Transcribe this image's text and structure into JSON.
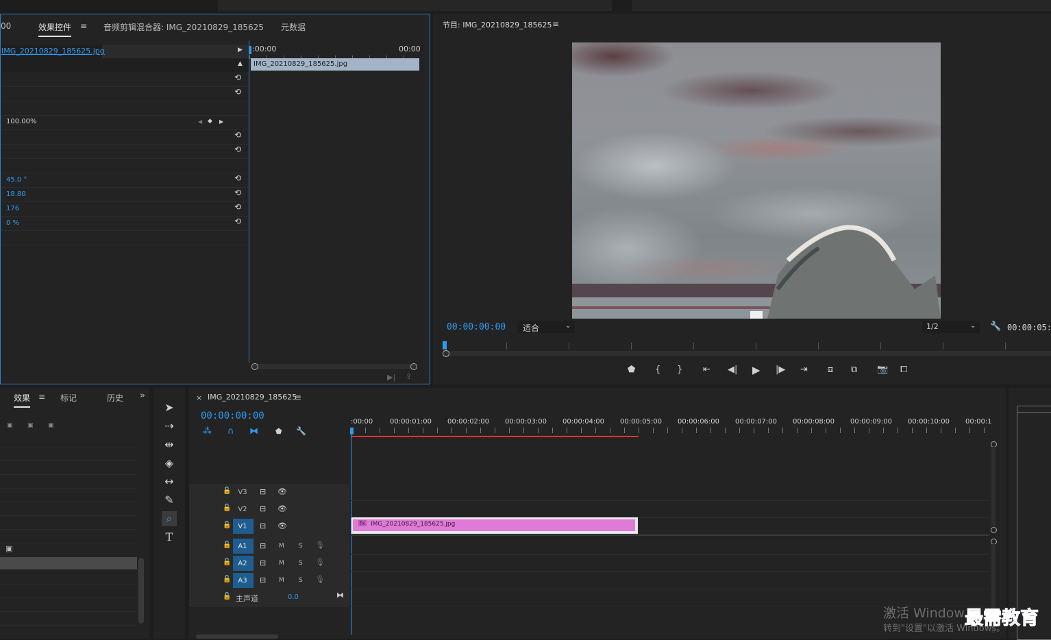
{
  "top_strip": {},
  "effect_controls": {
    "tab_partial": "00",
    "tabs": [
      "效果控件",
      "音频剪辑混合器: IMG_20210829_185625",
      "元数据"
    ],
    "clip_label": "IMG_20210829_185625.jpg",
    "time_start": ":00:00",
    "time_end": "00:00",
    "timeline_clip": "IMG_20210829_185625.jpg",
    "values": {
      "scale": "100.00%",
      "rotation": "45.0 °",
      "v1": "18.80",
      "v2": "176",
      "v3": "0 %"
    }
  },
  "program_monitor": {
    "title": "节目: IMG_20210829_185625",
    "timecode": "00:00:00:00",
    "fit_label": "适合",
    "resolution": "1/2",
    "duration": "00:00:05:0"
  },
  "effects_panel": {
    "tabs": [
      "效果",
      "标记",
      "历史"
    ]
  },
  "timeline": {
    "close": "×",
    "sequence_name": "IMG_20210829_185625",
    "timecode": "00:00:00:00",
    "ruler": [
      ":00:00",
      "00:00:01:00",
      "00:00:02:00",
      "00:00:03:00",
      "00:00:04:00",
      "00:00:05:00",
      "00:00:06:00",
      "00:00:07:00",
      "00:00:08:00",
      "00:00:09:00",
      "00:00:10:00",
      "00:00:1"
    ],
    "tracks_video": [
      "V3",
      "V2",
      "V1"
    ],
    "tracks_audio": [
      "A1",
      "A2",
      "A3"
    ],
    "master_label": "主声道",
    "master_value": "0.0",
    "mute": "M",
    "solo": "S",
    "clip_label": "IMG_20210829_185625.jpg",
    "clip_fx": "fx"
  },
  "watermark": {
    "activate_line1": "激活 Window",
    "activate_line2": "转到\"设置\"以激活 Windows。",
    "brand": "最需教育"
  },
  "colors": {
    "accent_blue": "#2f9bf0",
    "clip_pink": "#e07ad8",
    "track_selected": "#1e5d8f",
    "work_area_red": "#e0322f"
  }
}
